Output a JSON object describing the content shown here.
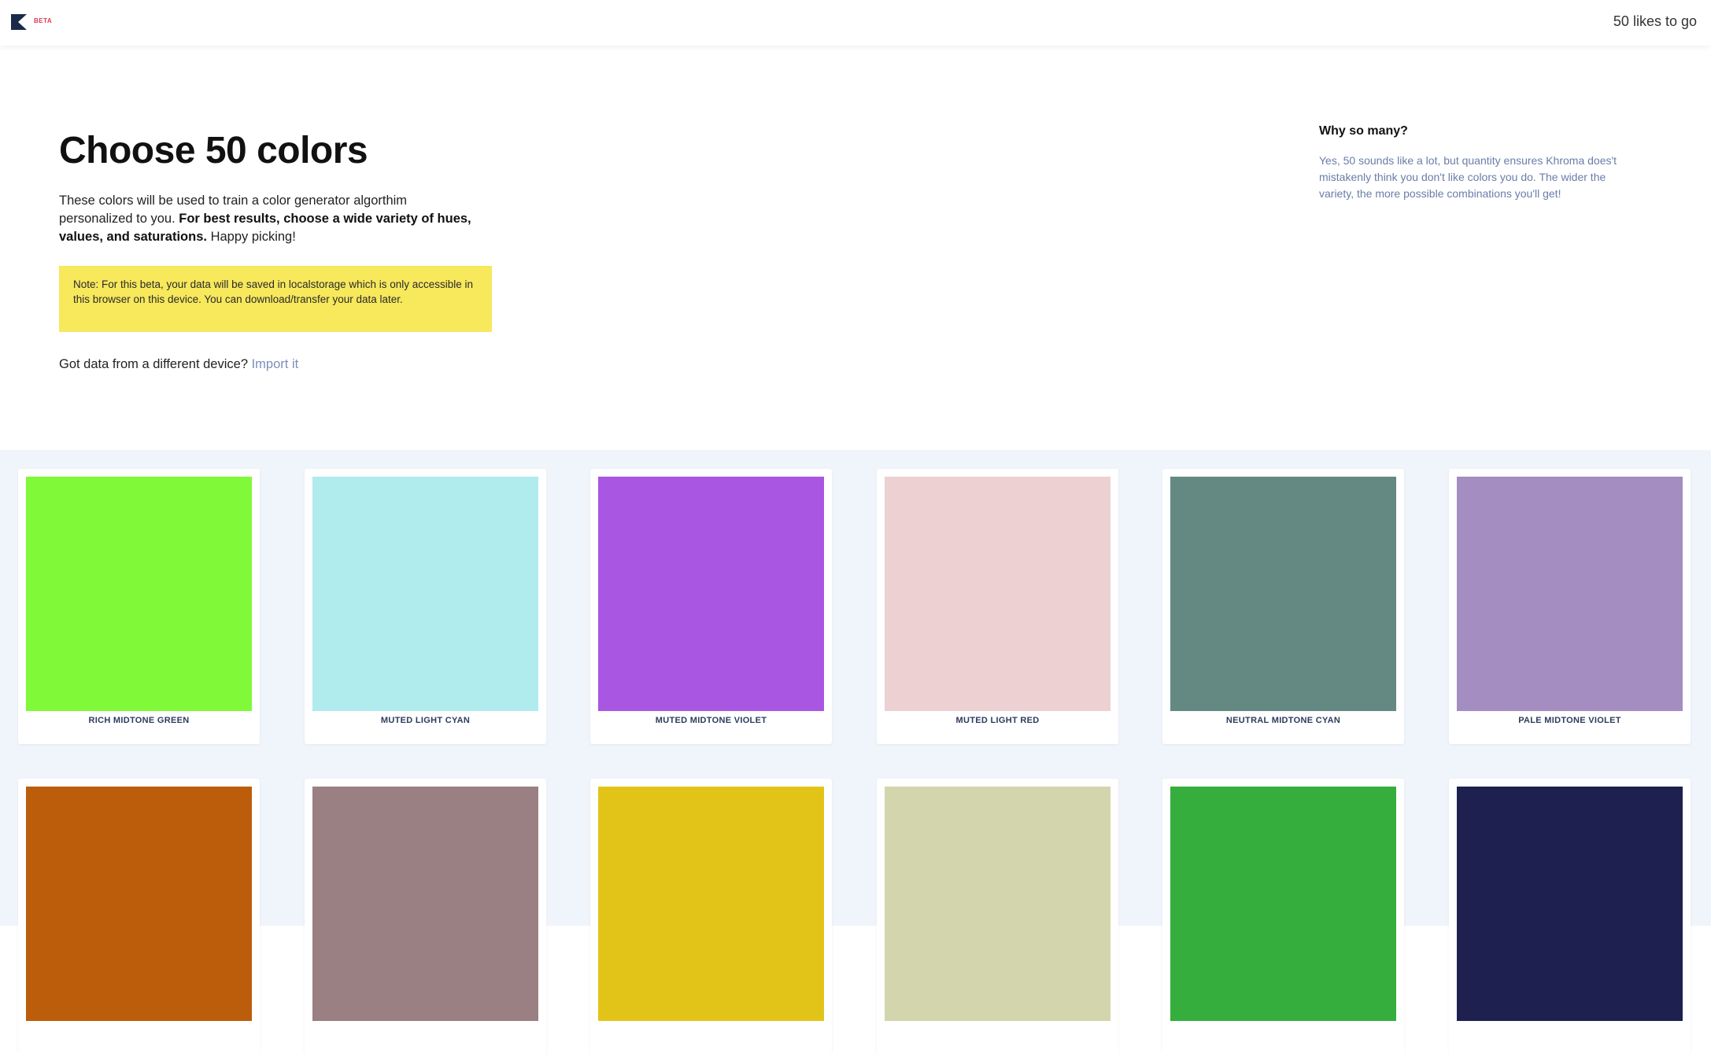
{
  "header": {
    "beta_label": "BETA",
    "likes_remaining": "50 likes to go"
  },
  "intro": {
    "title": "Choose 50 colors",
    "desc_part1": "These colors will be used to train a color generator algorthim personalized to you. ",
    "desc_bold": "For best results, choose a wide variety of hues, values, and saturations.",
    "desc_part2": " Happy picking!",
    "note": "Note: For this beta, your data will be saved in localstorage which is only accessible in this browser on this device. You can download/transfer your data later.",
    "import_prompt": "Got data from a different device? ",
    "import_link": "Import it"
  },
  "why": {
    "title": "Why so many?",
    "body": "Yes, 50 sounds like a lot, but quantity ensures Khroma does't mistakenly think you don't like colors you do. The wider the variety, the more possible combinations you'll get!"
  },
  "colors": [
    {
      "name": "RICH MIDTONE GREEN",
      "hex": "#7ff938"
    },
    {
      "name": "MUTED LIGHT CYAN",
      "hex": "#b0ebee"
    },
    {
      "name": "MUTED MIDTONE VIOLET",
      "hex": "#a957e2"
    },
    {
      "name": "MUTED LIGHT RED",
      "hex": "#ecd0d2"
    },
    {
      "name": "NEUTRAL MIDTONE CYAN",
      "hex": "#648983"
    },
    {
      "name": "PALE MIDTONE VIOLET",
      "hex": "#a48dc1"
    },
    {
      "name": "",
      "hex": "#bb5d0a"
    },
    {
      "name": "",
      "hex": "#9a8082"
    },
    {
      "name": "",
      "hex": "#e2c419"
    },
    {
      "name": "",
      "hex": "#d3d5ad"
    },
    {
      "name": "",
      "hex": "#36ae3e"
    },
    {
      "name": "",
      "hex": "#1e2050"
    }
  ]
}
